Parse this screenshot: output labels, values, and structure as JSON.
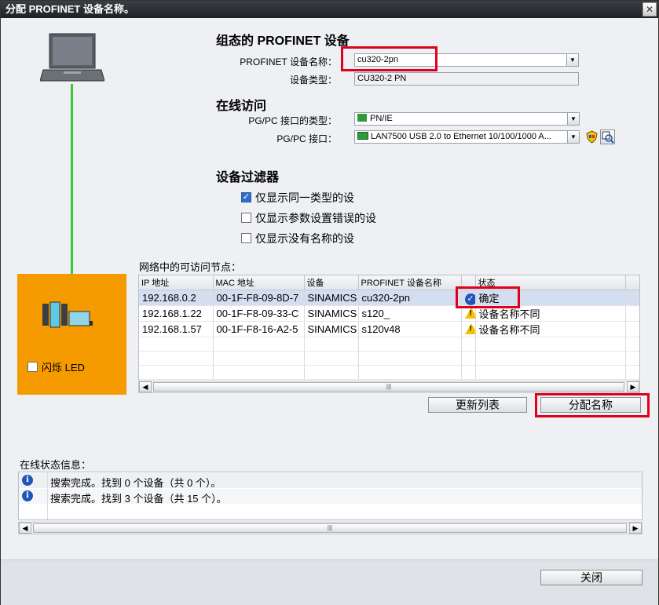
{
  "window": {
    "title": "分配 PROFINET 设备名称。",
    "close_glyph": "✕"
  },
  "configured": {
    "heading": "组态的 PROFINET 设备",
    "name_label": "PROFINET 设备名称：",
    "name_value": "cu320-2pn",
    "type_label": "设备类型：",
    "type_value": "CU320-2 PN"
  },
  "online": {
    "heading": "在线访问",
    "iface_type_label": "PG/PC 接口的类型：",
    "iface_type_value": "PN/IE",
    "iface_label": "PG/PC 接口：",
    "iface_value": "LAN7500 USB 2.0 to Ethernet 10/100/1000 A..."
  },
  "filter": {
    "heading": "设备过滤器",
    "options": [
      {
        "label": "仅显示同一类型的设",
        "checked": true
      },
      {
        "label": "仅显示参数设置错误的设",
        "checked": false
      },
      {
        "label": "仅显示没有名称的设",
        "checked": false
      }
    ]
  },
  "nodes": {
    "title": "网络中的可访问节点：",
    "columns": [
      "IP 地址",
      "MAC 地址",
      "设备",
      "PROFINET 设备名称",
      "状态"
    ],
    "rows": [
      {
        "ip": "192.168.0.2",
        "mac": "00-1F-F8-09-8D-7",
        "device": "SINAMICS S",
        "name": "cu320-2pn",
        "status": "确定",
        "status_icon": "check-icon"
      },
      {
        "ip": "192.168.1.22",
        "mac": "00-1F-F8-09-33-C",
        "device": "SINAMICS S",
        "name": "s120_",
        "status": "设备名称不同",
        "status_icon": "warning-icon"
      },
      {
        "ip": "192.168.1.57",
        "mac": "00-1F-F8-16-A2-5",
        "device": "SINAMICS S",
        "name": "s120v48",
        "status": "设备名称不同",
        "status_icon": "warning-icon"
      }
    ]
  },
  "buttons": {
    "refresh": "更新列表",
    "assign": "分配名称",
    "close": "关闭"
  },
  "led": {
    "label": "闪烁 LED"
  },
  "status_info": {
    "title": "在线状态信息：",
    "messages": [
      "搜索完成。找到 0 个设备（共 0 个）。",
      "搜索完成。找到 3 个设备（共 15 个）。"
    ]
  },
  "colors": {
    "highlight_red": "#e0001b",
    "orange_panel": "#f59b00",
    "link_green": "#33cc33",
    "selected_row": "#d3dff0"
  }
}
